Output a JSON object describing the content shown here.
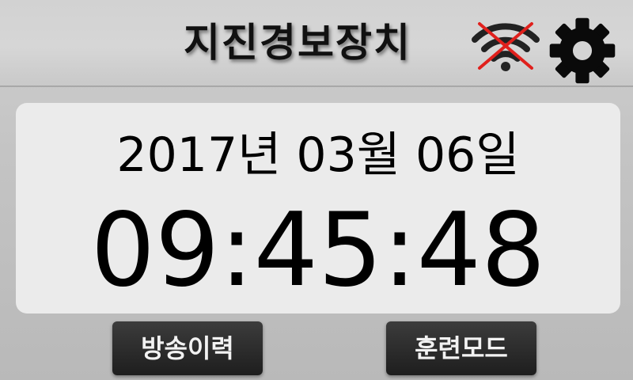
{
  "header": {
    "title": "지진경보장치",
    "wifi_icon": "wifi-off-icon",
    "wifi_color": "#222222",
    "wifi_cross_color": "#e0201c",
    "settings_icon": "gear-icon"
  },
  "clock": {
    "date": "2017년 03월 06일",
    "time": "09:45:48"
  },
  "buttons": {
    "history_label": "방송이력",
    "training_label": "훈련모드"
  },
  "colors": {
    "panel_bg": "#ebebeb",
    "button_bg": "#2a2a2a",
    "button_text": "#f2f2f2"
  }
}
